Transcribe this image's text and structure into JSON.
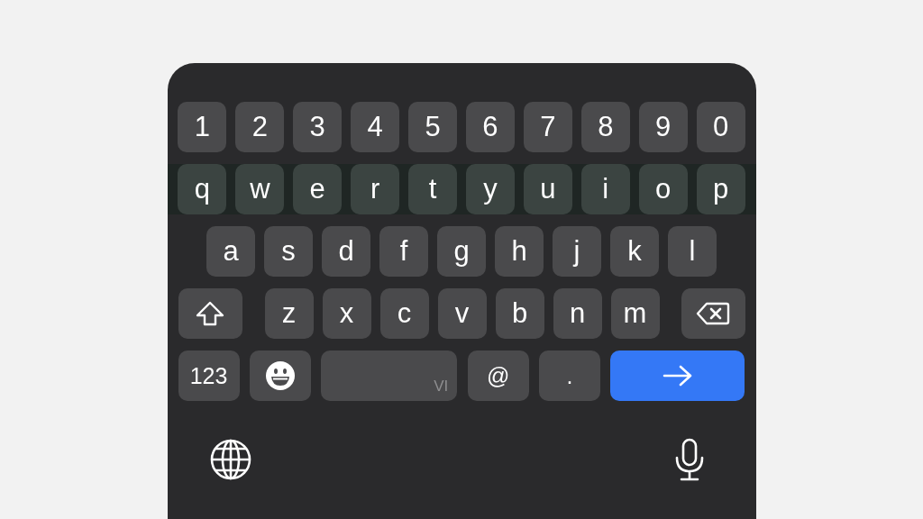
{
  "rows": [
    {
      "keys": [
        {
          "kind": "char",
          "label": "1"
        },
        {
          "kind": "char",
          "label": "2"
        },
        {
          "kind": "char",
          "label": "3"
        },
        {
          "kind": "char",
          "label": "4"
        },
        {
          "kind": "char",
          "label": "5"
        },
        {
          "kind": "char",
          "label": "6"
        },
        {
          "kind": "char",
          "label": "7"
        },
        {
          "kind": "char",
          "label": "8"
        },
        {
          "kind": "char",
          "label": "9"
        },
        {
          "kind": "char",
          "label": "0"
        }
      ]
    },
    {
      "keys": [
        {
          "kind": "char",
          "label": "q"
        },
        {
          "kind": "char",
          "label": "w"
        },
        {
          "kind": "char",
          "label": "e"
        },
        {
          "kind": "char",
          "label": "r"
        },
        {
          "kind": "char",
          "label": "t"
        },
        {
          "kind": "char",
          "label": "y"
        },
        {
          "kind": "char",
          "label": "u"
        },
        {
          "kind": "char",
          "label": "i"
        },
        {
          "kind": "char",
          "label": "o"
        },
        {
          "kind": "char",
          "label": "p"
        }
      ]
    },
    {
      "keys": [
        {
          "kind": "char",
          "label": "a"
        },
        {
          "kind": "char",
          "label": "s"
        },
        {
          "kind": "char",
          "label": "d"
        },
        {
          "kind": "char",
          "label": "f"
        },
        {
          "kind": "char",
          "label": "g"
        },
        {
          "kind": "char",
          "label": "h"
        },
        {
          "kind": "char",
          "label": "j"
        },
        {
          "kind": "char",
          "label": "k"
        },
        {
          "kind": "char",
          "label": "l"
        }
      ]
    },
    {
      "keys": [
        {
          "kind": "shift"
        },
        {
          "kind": "char",
          "label": "z"
        },
        {
          "kind": "char",
          "label": "x"
        },
        {
          "kind": "char",
          "label": "c"
        },
        {
          "kind": "char",
          "label": "v"
        },
        {
          "kind": "char",
          "label": "b"
        },
        {
          "kind": "char",
          "label": "n"
        },
        {
          "kind": "char",
          "label": "m"
        },
        {
          "kind": "delete"
        }
      ]
    },
    {
      "keys": [
        {
          "kind": "numbers",
          "label": "123"
        },
        {
          "kind": "emoji"
        },
        {
          "kind": "space",
          "label": "VI"
        },
        {
          "kind": "char",
          "label": "@"
        },
        {
          "kind": "char",
          "label": "."
        },
        {
          "kind": "go"
        }
      ]
    }
  ]
}
